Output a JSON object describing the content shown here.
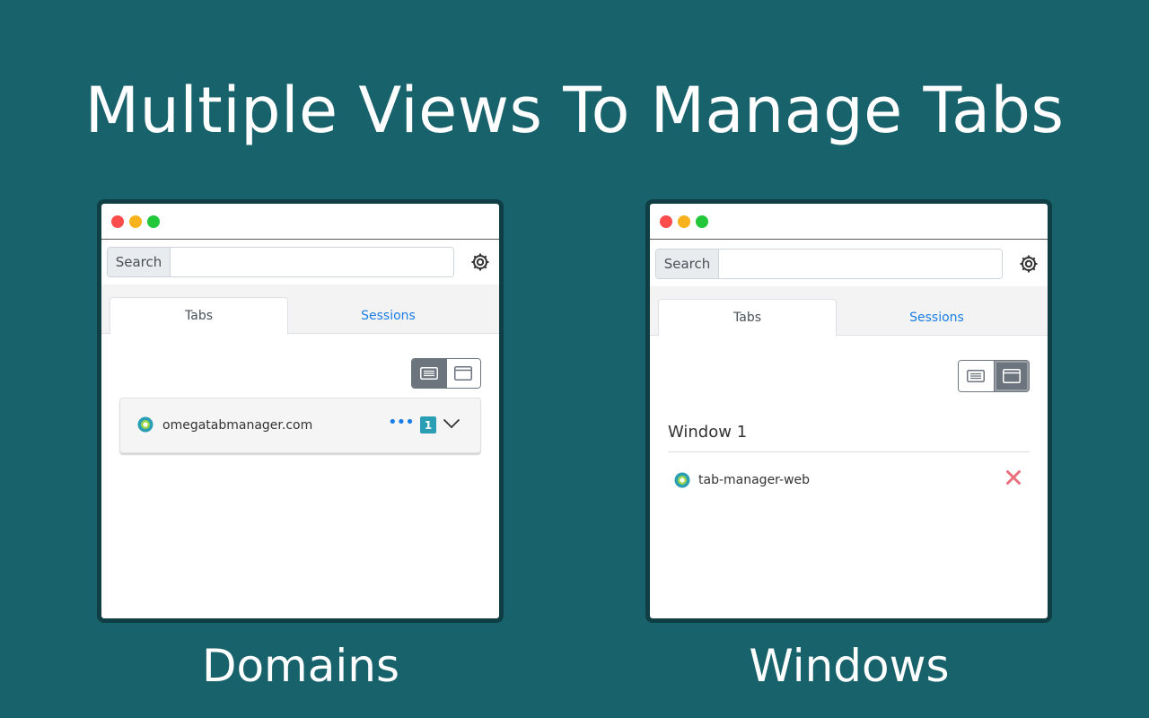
{
  "headline": "Multiple Views To Manage Tabs",
  "colors": {
    "background": "#18626c",
    "accent_link": "#1a7ee6",
    "badge": "#2a9fb4",
    "close": "#e8707c"
  },
  "panels": {
    "domains": {
      "caption": "Domains",
      "search_label": "Search",
      "search_value": "",
      "tabs": [
        "Tabs",
        "Sessions"
      ],
      "active_tab": "Tabs",
      "view_mode": "list",
      "domain_item": {
        "name": "omegatabmanager.com",
        "more": "•••",
        "count": "1"
      }
    },
    "windows": {
      "caption": "Windows",
      "search_label": "Search",
      "search_value": "",
      "tabs": [
        "Tabs",
        "Sessions"
      ],
      "active_tab": "Tabs",
      "view_mode": "window",
      "window_title": "Window 1",
      "tab_item": {
        "title": "tab-manager-web"
      }
    }
  },
  "icons": {
    "settings": "gear-icon",
    "list_view": "list-view-icon",
    "window_view": "window-view-icon",
    "favicon": "omega-favicon-icon",
    "expand": "chevron-down-icon",
    "close": "close-icon"
  }
}
